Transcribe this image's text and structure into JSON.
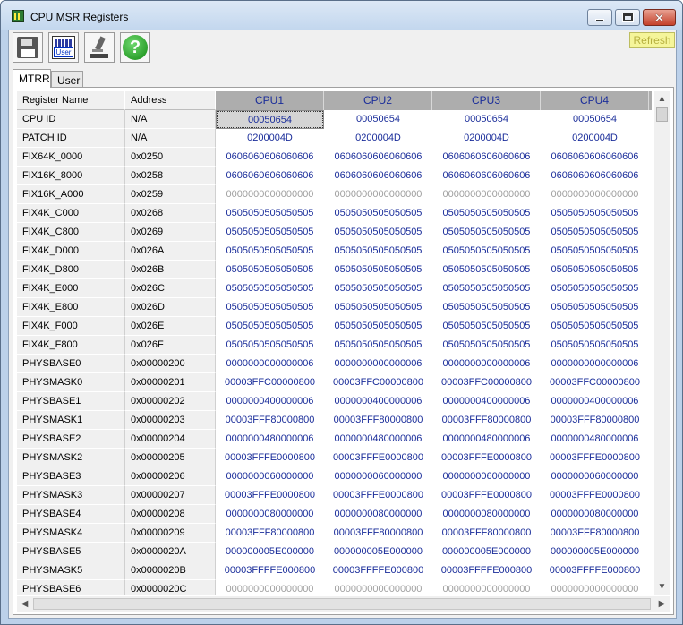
{
  "window": {
    "title": "CPU MSR Registers"
  },
  "toolbar": {
    "refresh_label": "Refresh",
    "user_icon_label": "User",
    "help_glyph": "?"
  },
  "tabs": [
    {
      "label": "MTRR",
      "active": true
    },
    {
      "label": "User",
      "active": false
    }
  ],
  "table": {
    "headers": [
      "Register Name",
      "Address",
      "CPU1",
      "CPU2",
      "CPU3",
      "CPU4"
    ],
    "rows": [
      {
        "name": "CPU ID",
        "address": "N/A",
        "values": [
          "00050654",
          "00050654",
          "00050654",
          "00050654"
        ]
      },
      {
        "name": "PATCH ID",
        "address": "N/A",
        "values": [
          "0200004D",
          "0200004D",
          "0200004D",
          "0200004D"
        ]
      },
      {
        "name": "FIX64K_0000",
        "address": "0x0250",
        "values": [
          "0606060606060606",
          "0606060606060606",
          "0606060606060606",
          "0606060606060606"
        ]
      },
      {
        "name": "FIX16K_8000",
        "address": "0x0258",
        "values": [
          "0606060606060606",
          "0606060606060606",
          "0606060606060606",
          "0606060606060606"
        ]
      },
      {
        "name": "FIX16K_A000",
        "address": "0x0259",
        "values": [
          "0000000000000000",
          "0000000000000000",
          "0000000000000000",
          "0000000000000000"
        ]
      },
      {
        "name": "FIX4K_C000",
        "address": "0x0268",
        "values": [
          "0505050505050505",
          "0505050505050505",
          "0505050505050505",
          "0505050505050505"
        ]
      },
      {
        "name": "FIX4K_C800",
        "address": "0x0269",
        "values": [
          "0505050505050505",
          "0505050505050505",
          "0505050505050505",
          "0505050505050505"
        ]
      },
      {
        "name": "FIX4K_D000",
        "address": "0x026A",
        "values": [
          "0505050505050505",
          "0505050505050505",
          "0505050505050505",
          "0505050505050505"
        ]
      },
      {
        "name": "FIX4K_D800",
        "address": "0x026B",
        "values": [
          "0505050505050505",
          "0505050505050505",
          "0505050505050505",
          "0505050505050505"
        ]
      },
      {
        "name": "FIX4K_E000",
        "address": "0x026C",
        "values": [
          "0505050505050505",
          "0505050505050505",
          "0505050505050505",
          "0505050505050505"
        ]
      },
      {
        "name": "FIX4K_E800",
        "address": "0x026D",
        "values": [
          "0505050505050505",
          "0505050505050505",
          "0505050505050505",
          "0505050505050505"
        ]
      },
      {
        "name": "FIX4K_F000",
        "address": "0x026E",
        "values": [
          "0505050505050505",
          "0505050505050505",
          "0505050505050505",
          "0505050505050505"
        ]
      },
      {
        "name": "FIX4K_F800",
        "address": "0x026F",
        "values": [
          "0505050505050505",
          "0505050505050505",
          "0505050505050505",
          "0505050505050505"
        ]
      },
      {
        "name": "PHYSBASE0",
        "address": "0x00000200",
        "values": [
          "0000000000000006",
          "0000000000000006",
          "0000000000000006",
          "0000000000000006"
        ]
      },
      {
        "name": "PHYSMASK0",
        "address": "0x00000201",
        "values": [
          "00003FFC00000800",
          "00003FFC00000800",
          "00003FFC00000800",
          "00003FFC00000800"
        ]
      },
      {
        "name": "PHYSBASE1",
        "address": "0x00000202",
        "values": [
          "0000000400000006",
          "0000000400000006",
          "0000000400000006",
          "0000000400000006"
        ]
      },
      {
        "name": "PHYSMASK1",
        "address": "0x00000203",
        "values": [
          "00003FFF80000800",
          "00003FFF80000800",
          "00003FFF80000800",
          "00003FFF80000800"
        ]
      },
      {
        "name": "PHYSBASE2",
        "address": "0x00000204",
        "values": [
          "0000000480000006",
          "0000000480000006",
          "0000000480000006",
          "0000000480000006"
        ]
      },
      {
        "name": "PHYSMASK2",
        "address": "0x00000205",
        "values": [
          "00003FFFE0000800",
          "00003FFFE0000800",
          "00003FFFE0000800",
          "00003FFFE0000800"
        ]
      },
      {
        "name": "PHYSBASE3",
        "address": "0x00000206",
        "values": [
          "0000000060000000",
          "0000000060000000",
          "0000000060000000",
          "0000000060000000"
        ]
      },
      {
        "name": "PHYSMASK3",
        "address": "0x00000207",
        "values": [
          "00003FFFE0000800",
          "00003FFFE0000800",
          "00003FFFE0000800",
          "00003FFFE0000800"
        ]
      },
      {
        "name": "PHYSBASE4",
        "address": "0x00000208",
        "values": [
          "0000000080000000",
          "0000000080000000",
          "0000000080000000",
          "0000000080000000"
        ]
      },
      {
        "name": "PHYSMASK4",
        "address": "0x00000209",
        "values": [
          "00003FFF80000800",
          "00003FFF80000800",
          "00003FFF80000800",
          "00003FFF80000800"
        ]
      },
      {
        "name": "PHYSBASE5",
        "address": "0x0000020A",
        "values": [
          "000000005E000000",
          "000000005E000000",
          "000000005E000000",
          "000000005E000000"
        ]
      },
      {
        "name": "PHYSMASK5",
        "address": "0x0000020B",
        "values": [
          "00003FFFFE000800",
          "00003FFFFE000800",
          "00003FFFFE000800",
          "00003FFFFE000800"
        ]
      },
      {
        "name": "PHYSBASE6",
        "address": "0x0000020C",
        "values": [
          "0000000000000000",
          "0000000000000000",
          "0000000000000000",
          "0000000000000000"
        ]
      }
    ]
  }
}
